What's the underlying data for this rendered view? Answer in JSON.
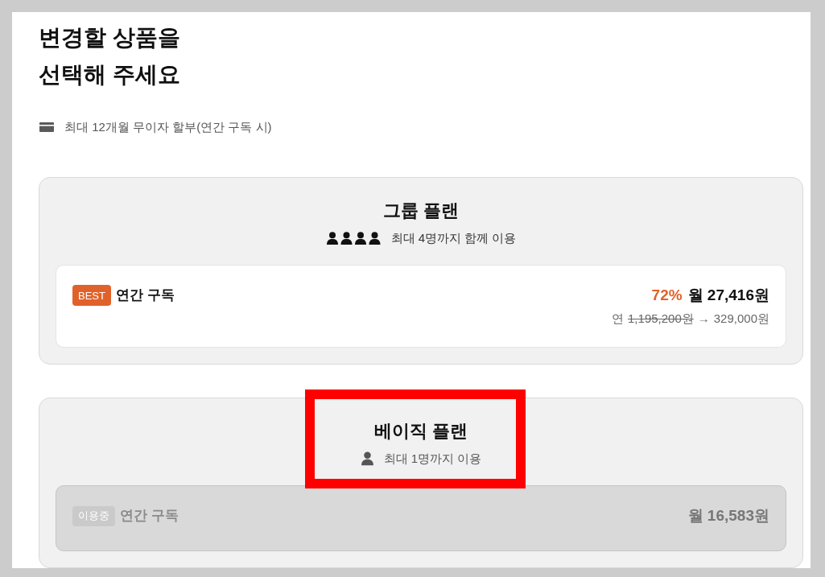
{
  "page": {
    "title": "변경할 상품을\n선택해 주세요",
    "note": "최대 12개월 무이자 할부(연간 구독 시)"
  },
  "plans": [
    {
      "kind": "group",
      "name": "그룹 플랜",
      "capacity": "최대 4명까지 함께 이용",
      "highlighted": false,
      "options": [
        {
          "badge": "BEST",
          "current": false,
          "name": "연간 구독",
          "discount": "72%",
          "monthly_price": "월 27,416원",
          "yearly_label": "연",
          "original_price": "1,195,200원",
          "arrow": "→",
          "yearly_price": "329,000원"
        }
      ]
    },
    {
      "kind": "single",
      "name": "베이직 플랜",
      "capacity": "최대 1명까지 이용",
      "highlighted": true,
      "options": [
        {
          "badge": "이용중",
          "current": true,
          "name": "연간 구독",
          "monthly_price": "월 16,583원"
        }
      ]
    }
  ]
}
